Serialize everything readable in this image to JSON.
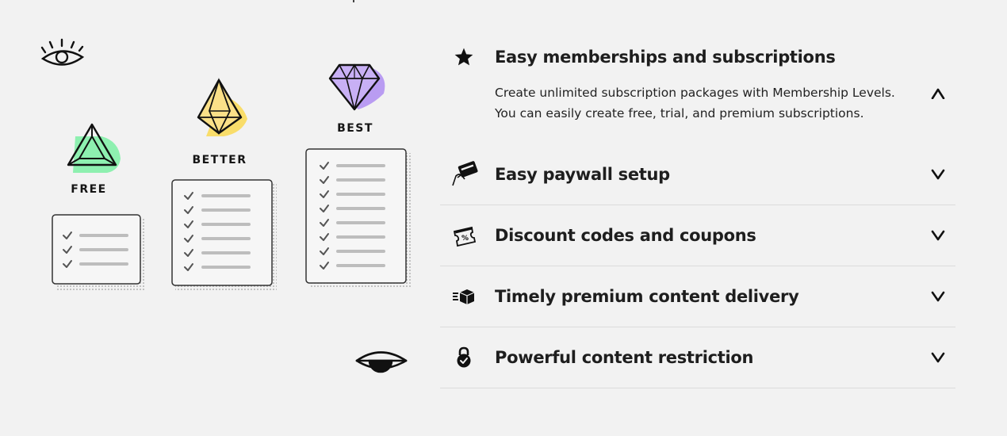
{
  "illustration": {
    "tiers": [
      {
        "label": "FREE",
        "color": "#8ef0b0",
        "items": 3
      },
      {
        "label": "BETTER",
        "color": "#f9dd6a",
        "items": 6
      },
      {
        "label": "BEST",
        "color": "#b99cf2",
        "items": 8
      }
    ],
    "decorative_icons": [
      "eye-open-icon",
      "eye-half-closed-icon"
    ]
  },
  "features": [
    {
      "title": "Easy memberships and subscriptions",
      "icon": "star-icon",
      "open": true,
      "description": "Create unlimited subscription packages with Membership Levels. You can easily create free, trial, and premium subscriptions."
    },
    {
      "title": "Easy paywall setup",
      "icon": "credit-card-icon",
      "open": false
    },
    {
      "title": "Discount codes and coupons",
      "icon": "coupon-icon",
      "open": false
    },
    {
      "title": "Timely premium content delivery",
      "icon": "delivery-box-icon",
      "open": false
    },
    {
      "title": "Powerful content restriction",
      "icon": "lock-icon",
      "open": false
    }
  ],
  "colors": {
    "background": "#f2f2f2",
    "text": "#1e1e1e",
    "divider": "#dcdcdc"
  }
}
